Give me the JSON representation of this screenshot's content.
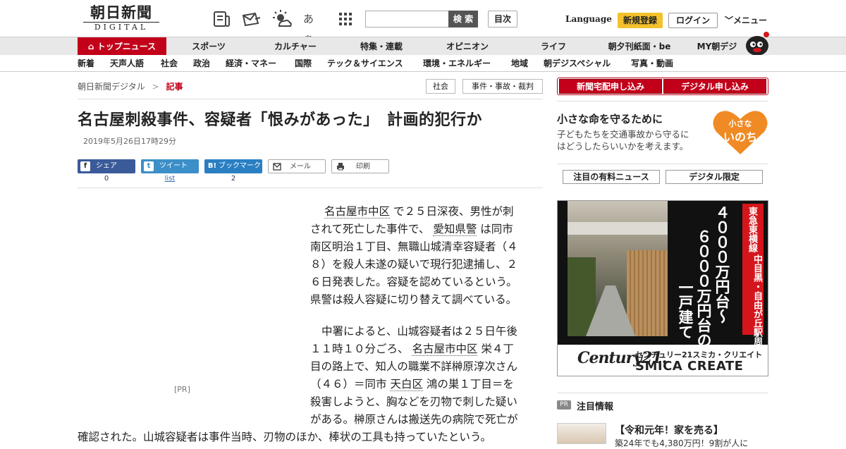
{
  "header": {
    "logo_jp": "朝日新聞",
    "logo_en": "DIGITAL",
    "search_button": "検 索",
    "index_button": "目次",
    "language": "Language",
    "register": "新規登録",
    "login": "ログイン",
    "menu": "メニュー",
    "font_size_glyph": "あぁ"
  },
  "nav_primary": [
    {
      "label": "トップニュース"
    },
    {
      "label": "スポーツ"
    },
    {
      "label": "カルチャー"
    },
    {
      "label": "特集・連載"
    },
    {
      "label": "オピニオン"
    },
    {
      "label": "ライフ"
    },
    {
      "label": "朝夕刊紙面・be"
    },
    {
      "label": "MY朝デジ"
    }
  ],
  "nav_secondary": [
    {
      "label": "新着"
    },
    {
      "label": "天声人語"
    },
    {
      "label": "社会"
    },
    {
      "label": "政治"
    },
    {
      "label": "経済・マネー"
    },
    {
      "label": "国際"
    },
    {
      "label": "テック＆サイエンス"
    },
    {
      "label": "環境・エネルギー"
    },
    {
      "label": "地域"
    },
    {
      "label": "朝デジスペシャル"
    },
    {
      "label": "写真・動画"
    }
  ],
  "breadcrumb": {
    "root": "朝日新聞デジタル",
    "sep": ">",
    "current": "記事"
  },
  "tags": [
    "社会",
    "事件・事故・裁判"
  ],
  "article": {
    "title": "名古屋刺殺事件、容疑者「恨みがあった」　計画的犯行か",
    "date": "2019年5月26日17時29分",
    "p1": {
      "kw1": "名古屋市中区",
      "t1": " で２５日深夜、男性が刺",
      "t2": "されて死亡した事件で、 ",
      "kw2": "愛知県警",
      "t3": " は同市",
      "t4": "南区明治１丁目、無職山城清幸容疑者（４",
      "t5": "８）を殺人未遂の疑いで現行犯逮捕し、２",
      "t6": "６日発表した。容疑を認めているという。",
      "t7": "県警は殺人容疑に切り替えて調べている。"
    },
    "p2": {
      "t1": "中署によると、山城容疑者は２５日午後",
      "t2": "１１時１０分ごろ、 ",
      "kw1": "名古屋市中区",
      "t3": " 栄４丁",
      "t4": "目の路上で、知人の職業不詳榊原淳次さん",
      "t5": "（４６）＝同市 ",
      "kw2": "天白区",
      "t6": " 鴻の巣１丁目＝を",
      "t7": "殺害しようと、胸などを刃物で刺した疑い",
      "t8": "がある。榊原さんは搬送先の病院で死亡が",
      "t9": "確認された。山城容疑者は事件当時、刃物のほか、棒状の工具も持っていたという。"
    },
    "pr_label": "[PR]"
  },
  "share": [
    {
      "label": "シェア",
      "icon": "f",
      "count": "0"
    },
    {
      "label": "ツイート",
      "icon": "t",
      "count": "list"
    },
    {
      "label": "ブックマーク",
      "icon": "B!",
      "count": "2"
    },
    {
      "label": "メール",
      "icon": "mail-icon"
    },
    {
      "label": "印刷",
      "icon": "print-icon"
    }
  ],
  "sidebar": {
    "subscribe_paper": "新聞宅配申し込み",
    "subscribe_digital": "デジタル申し込み",
    "campaign_title": "小さな命を守るために",
    "campaign_desc1": "子どもたちを交通事故から守るに",
    "campaign_desc2": "はどうしたらいいかを考えます。",
    "campaign_logo1": "小さな",
    "campaign_logo2": "いのち",
    "btn_paid": "注目の有料ニュース",
    "btn_digital": "デジタル限定",
    "ad": {
      "line_red": "東急東横線",
      "line_area": "中目黒・自由が丘駅周辺",
      "price1": "４０００万円台～",
      "price2": "６０００万円台の",
      "house": "一戸建て",
      "brand": "Century21.",
      "company_jp": "センチュリー21スミカ・クリエイト",
      "company_en": "SMICA CREATE"
    },
    "pr_badge": "PR",
    "attention": "注目情報",
    "promo_title": "【令和元年！家を売る】",
    "promo_desc": "築24年でも4,380万円！9割が人に"
  },
  "colors": {
    "brand_red": "#c2001a",
    "register_yellow": "#f3c12c"
  }
}
